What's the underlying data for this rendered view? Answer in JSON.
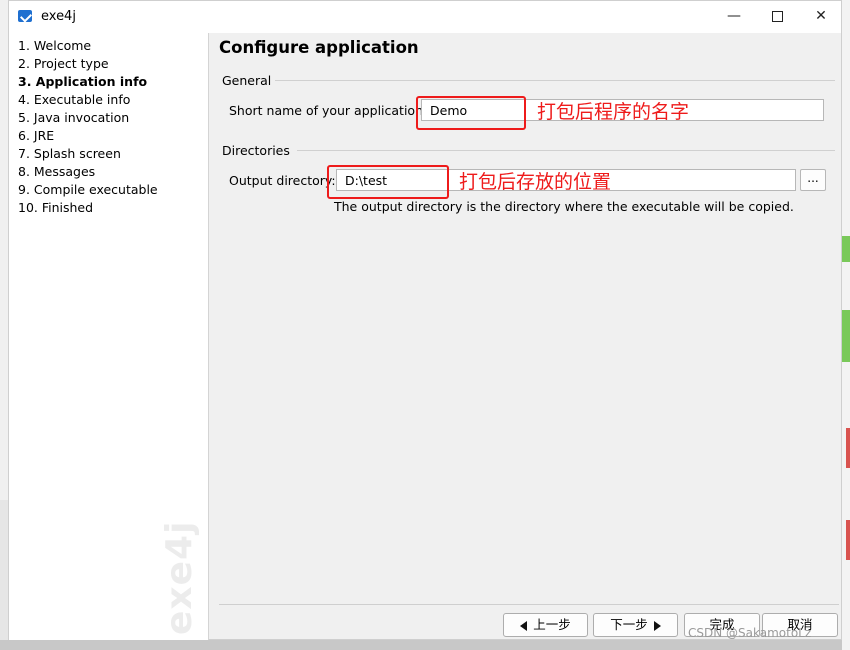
{
  "window": {
    "title": "exe4j",
    "brand_watermark": "exe4j"
  },
  "sidebar": {
    "steps": [
      {
        "label": "1. Welcome"
      },
      {
        "label": "2. Project type"
      },
      {
        "label": "3. Application info"
      },
      {
        "label": "4. Executable info"
      },
      {
        "label": "5. Java invocation"
      },
      {
        "label": "6. JRE"
      },
      {
        "label": "7. Splash screen"
      },
      {
        "label": "8. Messages"
      },
      {
        "label": "9. Compile executable"
      },
      {
        "label": "10. Finished"
      }
    ],
    "active_index": 2
  },
  "main": {
    "title": "Configure application",
    "general": {
      "heading": "General",
      "short_name_label": "Short name of your application:",
      "short_name_value": "Demo"
    },
    "directories": {
      "heading": "Directories",
      "output_label": "Output directory:",
      "output_value": "D:\\test",
      "browse_label": "...",
      "hint": "The output directory is the directory where the executable will be copied."
    }
  },
  "annotations": {
    "name_note": "打包后程序的名字",
    "dir_note": "打包后存放的位置",
    "color": "#ee1b1b"
  },
  "nav": {
    "back": "上一步",
    "next": "下一步",
    "finish": "完成",
    "cancel": "取消"
  },
  "footer_watermark": "CSDN @SakamotoLz"
}
